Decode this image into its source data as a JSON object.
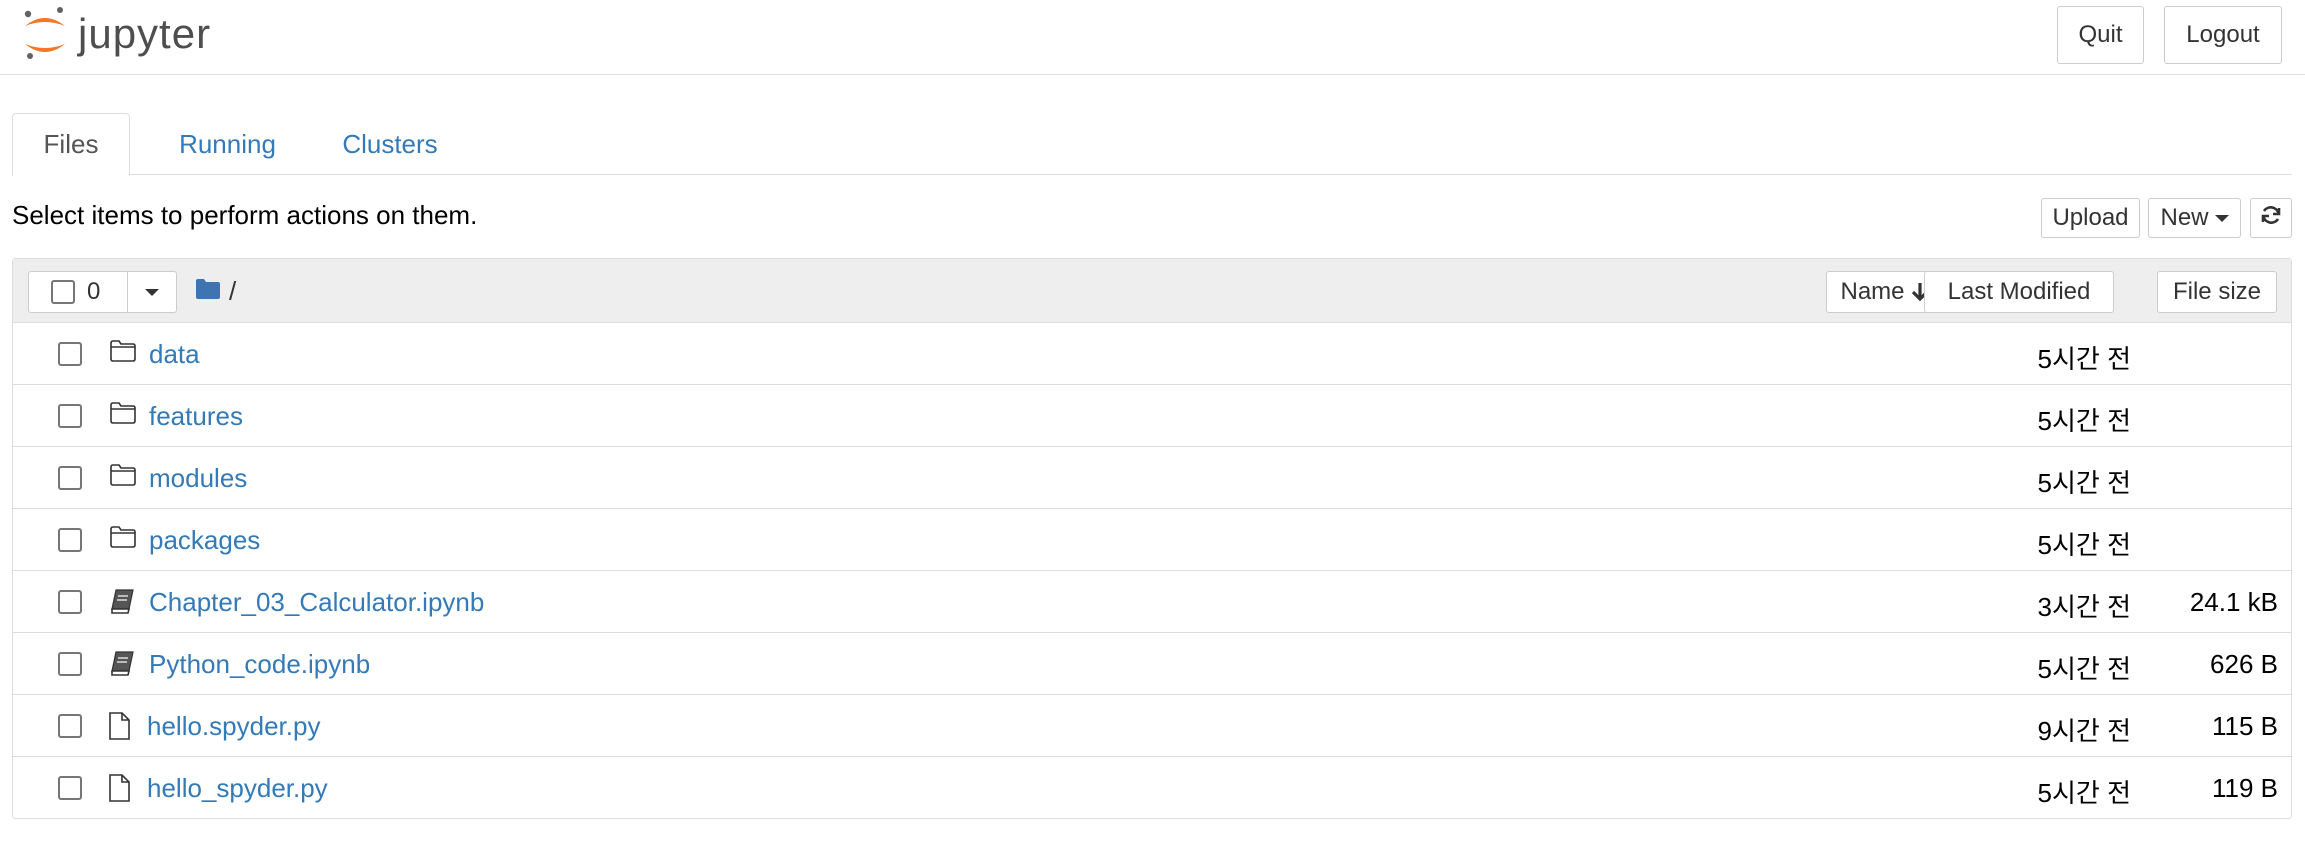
{
  "header": {
    "logo_text": "jupyter",
    "quit_label": "Quit",
    "logout_label": "Logout"
  },
  "tabs": [
    {
      "label": "Files",
      "active": true
    },
    {
      "label": "Running",
      "active": false
    },
    {
      "label": "Clusters",
      "active": false
    }
  ],
  "hint": "Select items to perform actions on them.",
  "toolbar": {
    "upload_label": "Upload",
    "new_label": "New"
  },
  "list": {
    "selected_count": "0",
    "breadcrumb_sep": "/",
    "sort_name_label": "Name",
    "sort_modified_label": "Last Modified",
    "sort_size_label": "File size",
    "items": [
      {
        "type": "folder",
        "name": "data",
        "modified": "5시간 전",
        "size": ""
      },
      {
        "type": "folder",
        "name": "features",
        "modified": "5시간 전",
        "size": ""
      },
      {
        "type": "folder",
        "name": "modules",
        "modified": "5시간 전",
        "size": ""
      },
      {
        "type": "folder",
        "name": "packages",
        "modified": "5시간 전",
        "size": ""
      },
      {
        "type": "notebook",
        "name": "Chapter_03_Calculator.ipynb",
        "modified": "3시간 전",
        "size": "24.1 kB"
      },
      {
        "type": "notebook",
        "name": "Python_code.ipynb",
        "modified": "5시간 전",
        "size": "626 B"
      },
      {
        "type": "file",
        "name": "hello.spyder.py",
        "modified": "9시간 전",
        "size": "115 B"
      },
      {
        "type": "file",
        "name": "hello_spyder.py",
        "modified": "5시간 전",
        "size": "119 B"
      }
    ]
  },
  "colors": {
    "link": "#337ab7",
    "logo_orange": "#f37726",
    "logo_gray": "#616262",
    "folder_blue": "#3f74b3"
  }
}
